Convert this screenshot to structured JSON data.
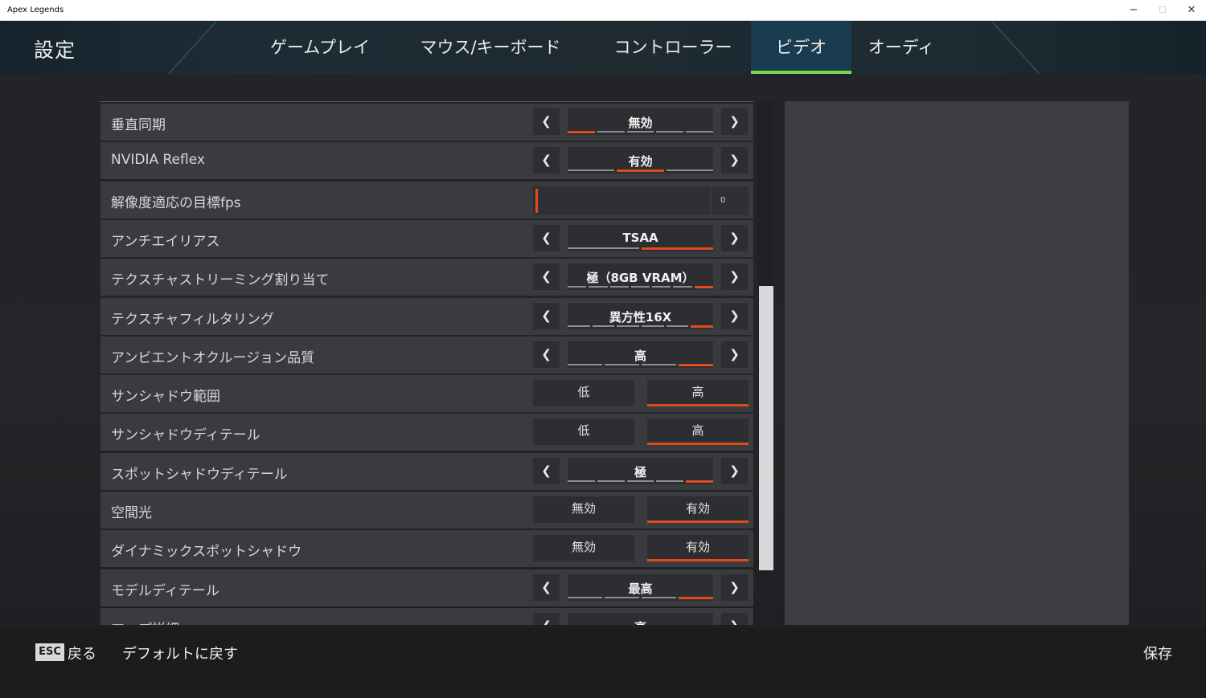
{
  "window": {
    "title": "Apex Legends",
    "controls": [
      "−",
      "☐",
      "✕"
    ]
  },
  "header": {
    "title": "設定",
    "tabs": [
      {
        "label": "ゲームプレイ"
      },
      {
        "label": "マウス/キーボード"
      },
      {
        "label": "コントローラー"
      },
      {
        "label": "ビデオ"
      },
      {
        "label": "オーディオ"
      }
    ],
    "active_tab": "ビデオ"
  },
  "arrows": {
    "left": "❮",
    "right": "❯"
  },
  "settings": [
    {
      "label": "垂直同期",
      "type": "selector",
      "value": "無効",
      "steps": 5,
      "selected_step": 1
    },
    {
      "label": "NVIDIA Reflex",
      "type": "selector",
      "value": "有効",
      "steps": 3,
      "selected_step": 2
    },
    {
      "label": "解像度適応の目標fps",
      "type": "slider",
      "value": "0"
    },
    {
      "label": "アンチエイリアス",
      "type": "selector",
      "value": "TSAA",
      "steps": 2,
      "selected_step": 2
    },
    {
      "label": "テクスチャストリーミング割り当て",
      "type": "selector",
      "value": "極（8GB VRAM）",
      "steps": 7,
      "selected_step": 7
    },
    {
      "label": "テクスチャフィルタリング",
      "type": "selector",
      "value": "異方性16X",
      "steps": 6,
      "selected_step": 6
    },
    {
      "label": "アンビエントオクルージョン品質",
      "type": "selector",
      "value": "高",
      "steps": 4,
      "selected_step": 4
    },
    {
      "label": "サンシャドウ範囲",
      "type": "toggle",
      "options": [
        "低",
        "高"
      ],
      "selected": 1
    },
    {
      "label": "サンシャドウディテール",
      "type": "toggle",
      "options": [
        "低",
        "高"
      ],
      "selected": 1
    },
    {
      "label": "スポットシャドウディテール",
      "type": "selector",
      "value": "極",
      "steps": 5,
      "selected_step": 5
    },
    {
      "label": "空間光",
      "type": "toggle",
      "options": [
        "無効",
        "有効"
      ],
      "selected": 1
    },
    {
      "label": "ダイナミックスポットシャドウ",
      "type": "toggle",
      "options": [
        "無効",
        "有効"
      ],
      "selected": 1
    },
    {
      "label": "モデルディテール",
      "type": "selector",
      "value": "最高",
      "steps": 4,
      "selected_step": 4
    },
    {
      "label": "マップ詳細",
      "type": "selector",
      "value": "高",
      "steps": 3,
      "selected_step": 3
    }
  ],
  "footer": {
    "esc_key": "ESC",
    "back_label": "戻る",
    "default_label": "デフォルトに戻す",
    "save_label": "保存"
  },
  "colors": {
    "accent": "#e24a1a",
    "tab_active_underline": "#7fd64d",
    "tab_active_bg": "#1a3c50"
  }
}
